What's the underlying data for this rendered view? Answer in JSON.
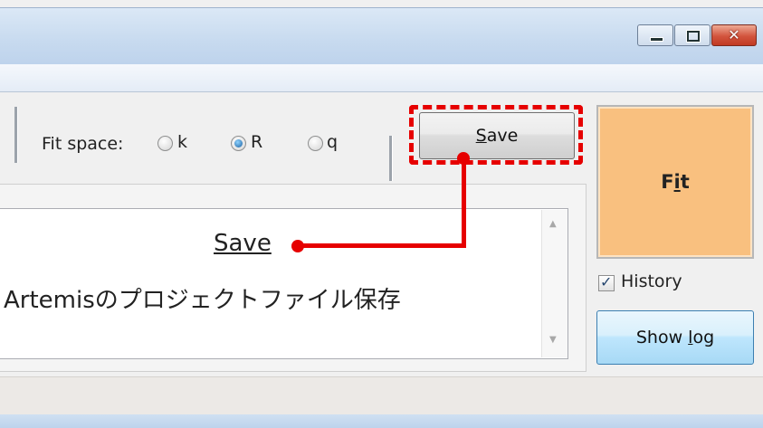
{
  "window": {
    "minimize_icon": "minimize-icon",
    "maximize_icon": "maximize-icon",
    "close_icon": "close-icon",
    "close_glyph": "✕"
  },
  "toolbar": {
    "fit_space_label": "Fit space:",
    "options": [
      {
        "label": "k",
        "selected": false
      },
      {
        "label": "R",
        "selected": true
      },
      {
        "label": "q",
        "selected": false
      }
    ],
    "save_button": {
      "accel": "S",
      "rest": "ave"
    }
  },
  "right_panel": {
    "fit_button": {
      "pre": "F",
      "accel": "i",
      "post": "t"
    },
    "history_label": "History",
    "history_checked": true,
    "show_log_button": {
      "pre": "Show ",
      "accel": "l",
      "post": "og"
    }
  },
  "annotation": {
    "title": "Save",
    "description": "Artemisのプロジェクトファイル保存",
    "highlight_color": "#e60000"
  },
  "colors": {
    "fit_button": "#f9c07f",
    "show_log_button": "#bee6fd"
  }
}
